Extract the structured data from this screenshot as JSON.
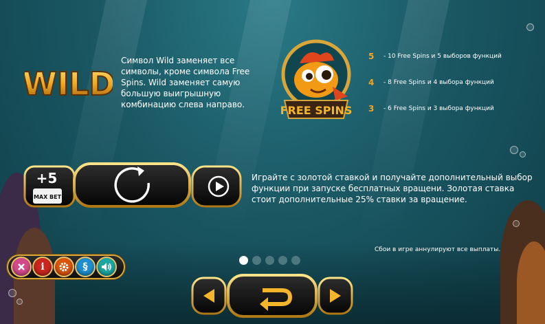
{
  "wild": {
    "logo_text": "WILD",
    "description": "Символ Wild заменяет все символы, кроме символа Free Spins. Wild заменяет самую большую выигрышную комбинацию слева направо."
  },
  "free_spins": {
    "logo_text": "FREE SPINS",
    "payouts": [
      {
        "count": "5",
        "text": "- 10 Free Spins и 5 выборов функций"
      },
      {
        "count": "4",
        "text": "- 8 Free Spins и 4 выбора функций"
      },
      {
        "count": "3",
        "text": "- 6 Free Spins и 3 выбора функций"
      }
    ]
  },
  "gold_bet": {
    "plus_label": "+5",
    "max_bet_label": "MAX BET",
    "description": "Играйте с золотой ставкой и получайте дополнительный выбор функции при запуске бесплатных вращени. Золотая ставка стоит дополнительные 25% ставки за вращение."
  },
  "disclaimer": "Сбои в игре аннулируют все выплаты.",
  "menu": {
    "close_icon": "close-icon",
    "info_icon": "info-icon",
    "settings_icon": "gear-icon",
    "rules_icon": "section-icon",
    "sound_icon": "speaker-icon",
    "rules_glyph": "§",
    "info_glyph": "i"
  },
  "pagination": {
    "total": 5,
    "current": 1
  },
  "colors": {
    "accent_gold": "#e8b53a",
    "number_orange": "#f7a41d",
    "water": "#1a5864"
  }
}
